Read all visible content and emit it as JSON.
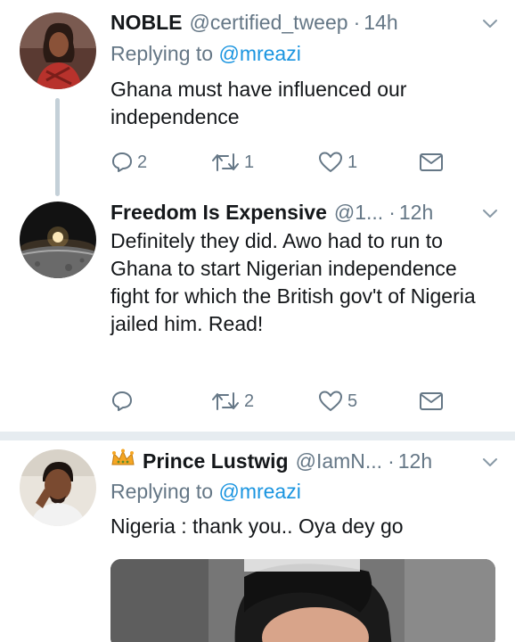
{
  "colors": {
    "accent": "#1b95e0",
    "muted": "#657786",
    "text": "#14171a",
    "divider": "#e6ecf0"
  },
  "tweets": [
    {
      "name": "NOBLE",
      "handle": "@certified_tweep",
      "time": "14h",
      "replying_prefix": "Replying to",
      "replying_to": "@mreazi",
      "text": "Ghana must have influenced our independence",
      "replies": "2",
      "retweets": "1",
      "likes": "1"
    },
    {
      "name": "Freedom Is Expensive",
      "handle": "@1...",
      "time": "12h",
      "text": "Definitely they did. Awo had to run to Ghana to start Nigerian independence fight for which the British gov't of Nigeria jailed him. Read!",
      "retweets": "2",
      "likes": "5"
    },
    {
      "name_prefix_icon": "crown-icon",
      "name": "Prince Lustwig",
      "handle": "@IamN...",
      "time": "12h",
      "replying_prefix": "Replying to",
      "replying_to": "@mreazi",
      "text": "Nigeria : thank you.. Oya dey go"
    }
  ],
  "icons": [
    "reply-icon",
    "retweet-icon",
    "like-icon",
    "dm-icon",
    "chevron-down-icon"
  ]
}
